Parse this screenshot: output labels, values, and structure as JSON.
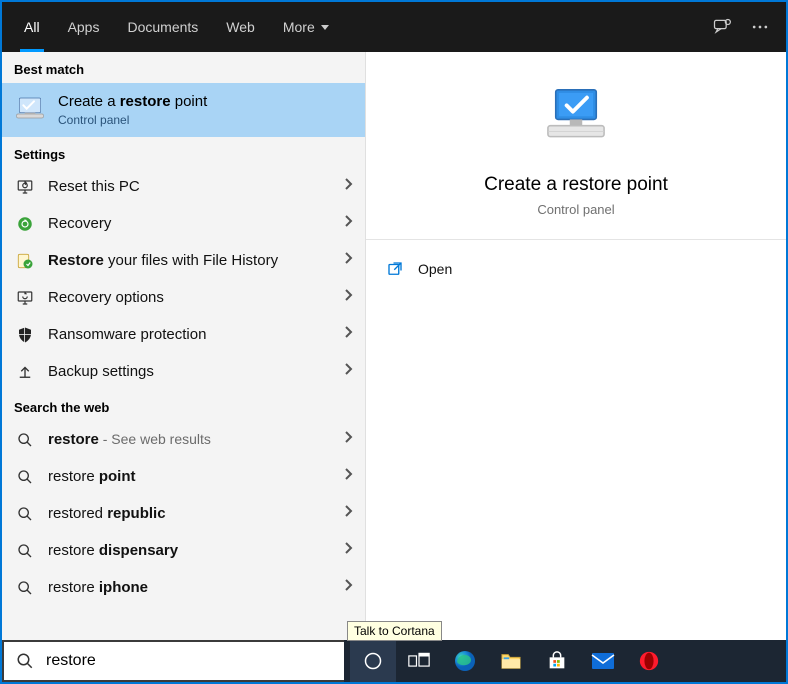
{
  "tabs": {
    "all": "All",
    "apps": "Apps",
    "documents": "Documents",
    "web": "Web",
    "more": "More"
  },
  "sections": {
    "best_match": "Best match",
    "settings": "Settings",
    "search_web": "Search the web"
  },
  "best": {
    "title_prefix": "Create a ",
    "title_bold": "restore",
    "title_suffix": " point",
    "subtitle": "Control panel"
  },
  "settings_items": [
    {
      "label": "Reset this PC"
    },
    {
      "label": "Recovery"
    },
    {
      "label_bold_prefix": "Restore",
      "label_rest": " your files with File History"
    },
    {
      "label": "Recovery options"
    },
    {
      "label": "Ransomware protection"
    },
    {
      "label": "Backup settings"
    }
  ],
  "web_items": [
    {
      "bold": "restore",
      "rest": "",
      "hint": " - See web results"
    },
    {
      "plain": "restore ",
      "bold": "point"
    },
    {
      "plain": "restored ",
      "bold": "republic"
    },
    {
      "plain": "restore ",
      "bold": "dispensary"
    },
    {
      "plain": "restore ",
      "bold": "iphone"
    }
  ],
  "preview": {
    "title": "Create a restore point",
    "subtitle": "Control panel",
    "open": "Open"
  },
  "tooltip": "Talk to Cortana",
  "search": {
    "value": "restore"
  }
}
